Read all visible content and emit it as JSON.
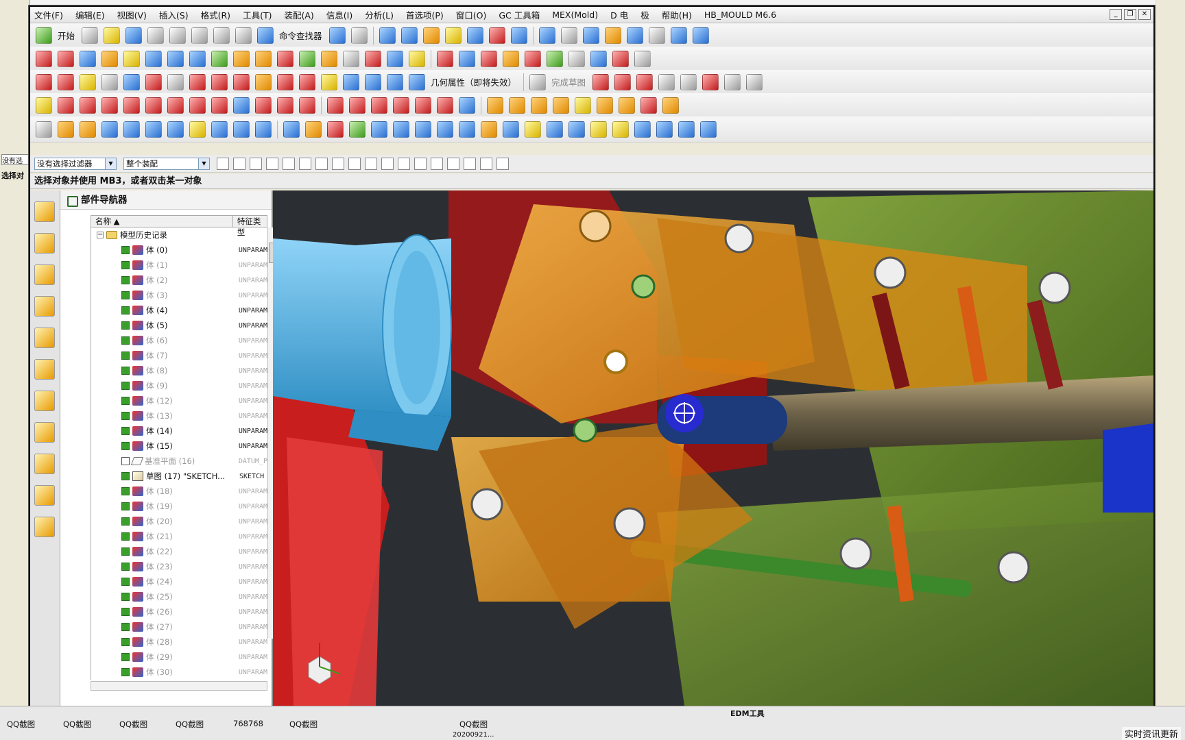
{
  "menu": {
    "items": [
      "文件(F)",
      "编辑(E)",
      "视图(V)",
      "插入(S)",
      "格式(R)",
      "工具(T)",
      "装配(A)",
      "信息(I)",
      "分析(L)",
      "首选项(P)",
      "窗口(O)",
      "GC 工具箱",
      "MEX(Mold)",
      "D 电",
      "极",
      "帮助(H)",
      "HB_MOULD M6.6"
    ]
  },
  "toolbar": {
    "start_label": "开始",
    "command_finder_label": "命令查找器",
    "geometry_property_label": "几何属性（即将失效）",
    "finish_sketch_label": "完成草图"
  },
  "filter_bar": {
    "selection_filter": "没有选择过滤器",
    "assembly_scope": "整个装配"
  },
  "status": {
    "prompt": "选择对象并使用 MB3，或者双击某一对象"
  },
  "navigator": {
    "title": "部件导航器",
    "col_name": "名称",
    "col_type": "特征类型",
    "root": "模型历史记录",
    "rows": [
      {
        "label": "体 (0)",
        "type": "UNPARAM",
        "dim": false
      },
      {
        "label": "体 (1)",
        "type": "UNPARAM",
        "dim": true
      },
      {
        "label": "体 (2)",
        "type": "UNPARAM",
        "dim": true
      },
      {
        "label": "体 (3)",
        "type": "UNPARAM",
        "dim": true
      },
      {
        "label": "体 (4)",
        "type": "UNPARAM",
        "dim": false
      },
      {
        "label": "体 (5)",
        "type": "UNPARAM",
        "dim": false
      },
      {
        "label": "体 (6)",
        "type": "UNPARAM",
        "dim": true
      },
      {
        "label": "体 (7)",
        "type": "UNPARAM",
        "dim": true
      },
      {
        "label": "体 (8)",
        "type": "UNPARAM",
        "dim": true
      },
      {
        "label": "体 (9)",
        "type": "UNPARAM",
        "dim": true
      },
      {
        "label": "体 (12)",
        "type": "UNPARAM",
        "dim": true
      },
      {
        "label": "体 (13)",
        "type": "UNPARAM",
        "dim": true
      },
      {
        "label": "体 (14)",
        "type": "UNPARAM",
        "dim": false
      },
      {
        "label": "体 (15)",
        "type": "UNPARAM",
        "dim": false
      },
      {
        "label": "基准平面 (16)",
        "type": "DATUM_P",
        "dim": true,
        "kind": "datum"
      },
      {
        "label": "草图 (17) \"SKETCH...",
        "type": "SKETCH",
        "dim": false,
        "kind": "sketch"
      },
      {
        "label": "体 (18)",
        "type": "UNPARAM",
        "dim": true
      },
      {
        "label": "体 (19)",
        "type": "UNPARAM",
        "dim": true
      },
      {
        "label": "体 (20)",
        "type": "UNPARAM",
        "dim": true
      },
      {
        "label": "体 (21)",
        "type": "UNPARAM",
        "dim": true
      },
      {
        "label": "体 (22)",
        "type": "UNPARAM",
        "dim": true
      },
      {
        "label": "体 (23)",
        "type": "UNPARAM",
        "dim": true
      },
      {
        "label": "体 (24)",
        "type": "UNPARAM",
        "dim": true
      },
      {
        "label": "体 (25)",
        "type": "UNPARAM",
        "dim": true
      },
      {
        "label": "体 (26)",
        "type": "UNPARAM",
        "dim": true
      },
      {
        "label": "体 (27)",
        "type": "UNPARAM",
        "dim": true
      },
      {
        "label": "体 (28)",
        "type": "UNPARAM",
        "dim": true
      },
      {
        "label": "体 (29)",
        "type": "UNPARAM",
        "dim": true
      },
      {
        "label": "体 (30)",
        "type": "UNPARAM",
        "dim": true
      }
    ]
  },
  "taskbar": {
    "items": [
      "QQ截图",
      "QQ截图",
      "QQ截图",
      "QQ截图",
      "768768",
      "QQ截图",
      "QQ截图"
    ],
    "edm_label": "EDM工具",
    "date_fragment": "20200921...",
    "news_label": "实时资讯更新"
  },
  "left_peek": {
    "status_fragment": "没有选",
    "prompt_fragment": "选择对"
  },
  "colors": {
    "viewport_bg": "#2b2f33",
    "mold_orange": "#f2a21f",
    "mold_red": "#c81e1e",
    "mold_green": "#7fae2f",
    "mold_blue": "#1a33c8",
    "mold_cyan": "#4fb6e8"
  }
}
